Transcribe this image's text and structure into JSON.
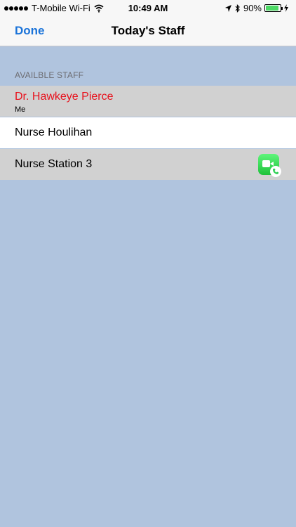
{
  "status_bar": {
    "carrier": "T-Mobile Wi-Fi",
    "time": "10:49 AM",
    "battery": "90%",
    "icons": [
      "signal-dots-icon",
      "wifi-icon",
      "location-arrow-icon",
      "bluetooth-icon",
      "battery-icon",
      "charging-bolt-icon"
    ]
  },
  "nav": {
    "done_label": "Done",
    "title": "Today's Staff"
  },
  "section": {
    "header": "AVAILBLE STAFF"
  },
  "staff": [
    {
      "name": "Dr. Hawkeye Pierce",
      "subtitle": "Me",
      "color": "#e8111c"
    },
    {
      "name": "Nurse Houlihan"
    },
    {
      "name": "Nurse Station 3",
      "icon": "facetime-icon"
    }
  ],
  "colors": {
    "background": "#b0c4de",
    "accent": "#1a73d9",
    "highlight_name": "#e8111c",
    "facetime_green": "#34d058"
  }
}
